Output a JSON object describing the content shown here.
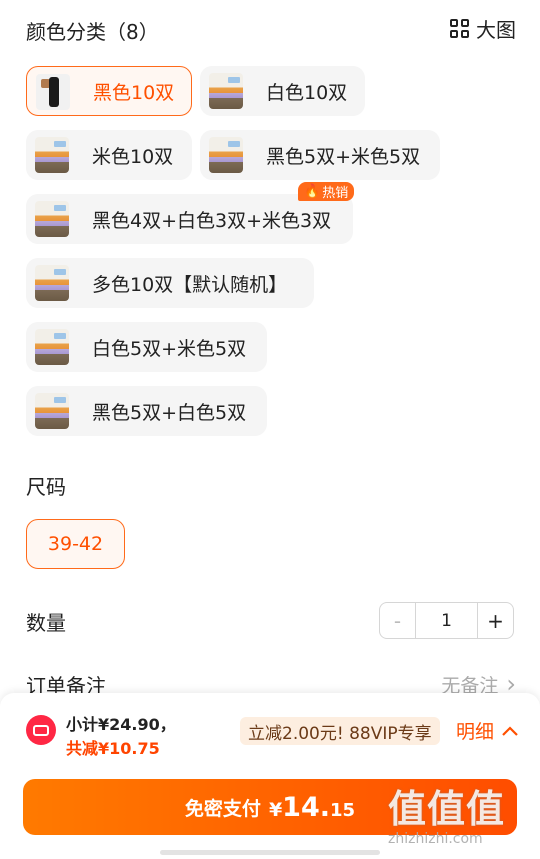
{
  "color_section": {
    "title": "颜色分类（8）",
    "big_view_label": "大图",
    "options": [
      {
        "label": "黑色10双",
        "selected": true
      },
      {
        "label": "白色10双",
        "selected": false
      },
      {
        "label": "米色10双",
        "selected": false
      },
      {
        "label": "黑色5双+米色5双",
        "selected": false
      },
      {
        "label": "黑色4双+白色3双+米色3双",
        "selected": false,
        "badge": "热销"
      },
      {
        "label": "多色10双【默认随机】",
        "selected": false
      },
      {
        "label": "白色5双+米色5双",
        "selected": false
      },
      {
        "label": "黑色5双+白色5双",
        "selected": false
      }
    ],
    "hot_badge": "热销"
  },
  "size_section": {
    "title": "尺码",
    "selected": "39-42"
  },
  "quantity_section": {
    "title": "数量",
    "minus": "-",
    "value": "1",
    "plus": "+"
  },
  "remark_section": {
    "title": "订单备注",
    "value": "无备注",
    "chevron": "›"
  },
  "checkout": {
    "subtotal": "小计¥24.90，",
    "discount": "共减¥10.75",
    "promo": "立减2.00元! 88VIP专享",
    "details": "明细",
    "pay_label": "免密支付",
    "pay_currency": "¥",
    "pay_int": "14.",
    "pay_dec": "15"
  },
  "watermark": {
    "main": "值值值",
    "sub": "zhizhizhi.com"
  },
  "colors": {
    "accent": "#ff5000",
    "pay_gradient_start": "#ff7a00",
    "pay_gradient_end": "#ff4d00",
    "chip_bg": "#f5f5f5"
  }
}
